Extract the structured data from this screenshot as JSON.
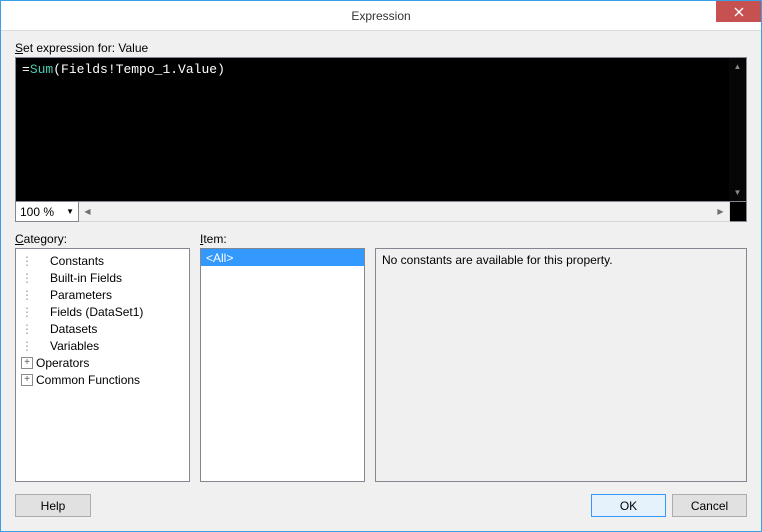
{
  "window": {
    "title": "Expression"
  },
  "setExpressionLabel": "Set expression for: Value",
  "editor": {
    "prefix": "=",
    "fn": "Sum",
    "open": "(",
    "body": "Fields!Tempo_1.Value",
    "close": ")"
  },
  "zoom": {
    "value": "100 %"
  },
  "labels": {
    "category": "Category:",
    "item": "Item:"
  },
  "categories": {
    "items": [
      {
        "label": "Constants",
        "expandable": false,
        "indent": true
      },
      {
        "label": "Built-in Fields",
        "expandable": false,
        "indent": true
      },
      {
        "label": "Parameters",
        "expandable": false,
        "indent": true
      },
      {
        "label": "Fields (DataSet1)",
        "expandable": false,
        "indent": true
      },
      {
        "label": "Datasets",
        "expandable": false,
        "indent": true
      },
      {
        "label": "Variables",
        "expandable": false,
        "indent": true
      },
      {
        "label": "Operators",
        "expandable": true,
        "indent": false
      },
      {
        "label": "Common Functions",
        "expandable": true,
        "indent": false
      }
    ]
  },
  "itemList": {
    "items": [
      {
        "label": "<All>",
        "selected": true
      }
    ]
  },
  "description": {
    "text": "No constants are available for this property."
  },
  "buttons": {
    "help": "Help",
    "ok": "OK",
    "cancel": "Cancel"
  }
}
